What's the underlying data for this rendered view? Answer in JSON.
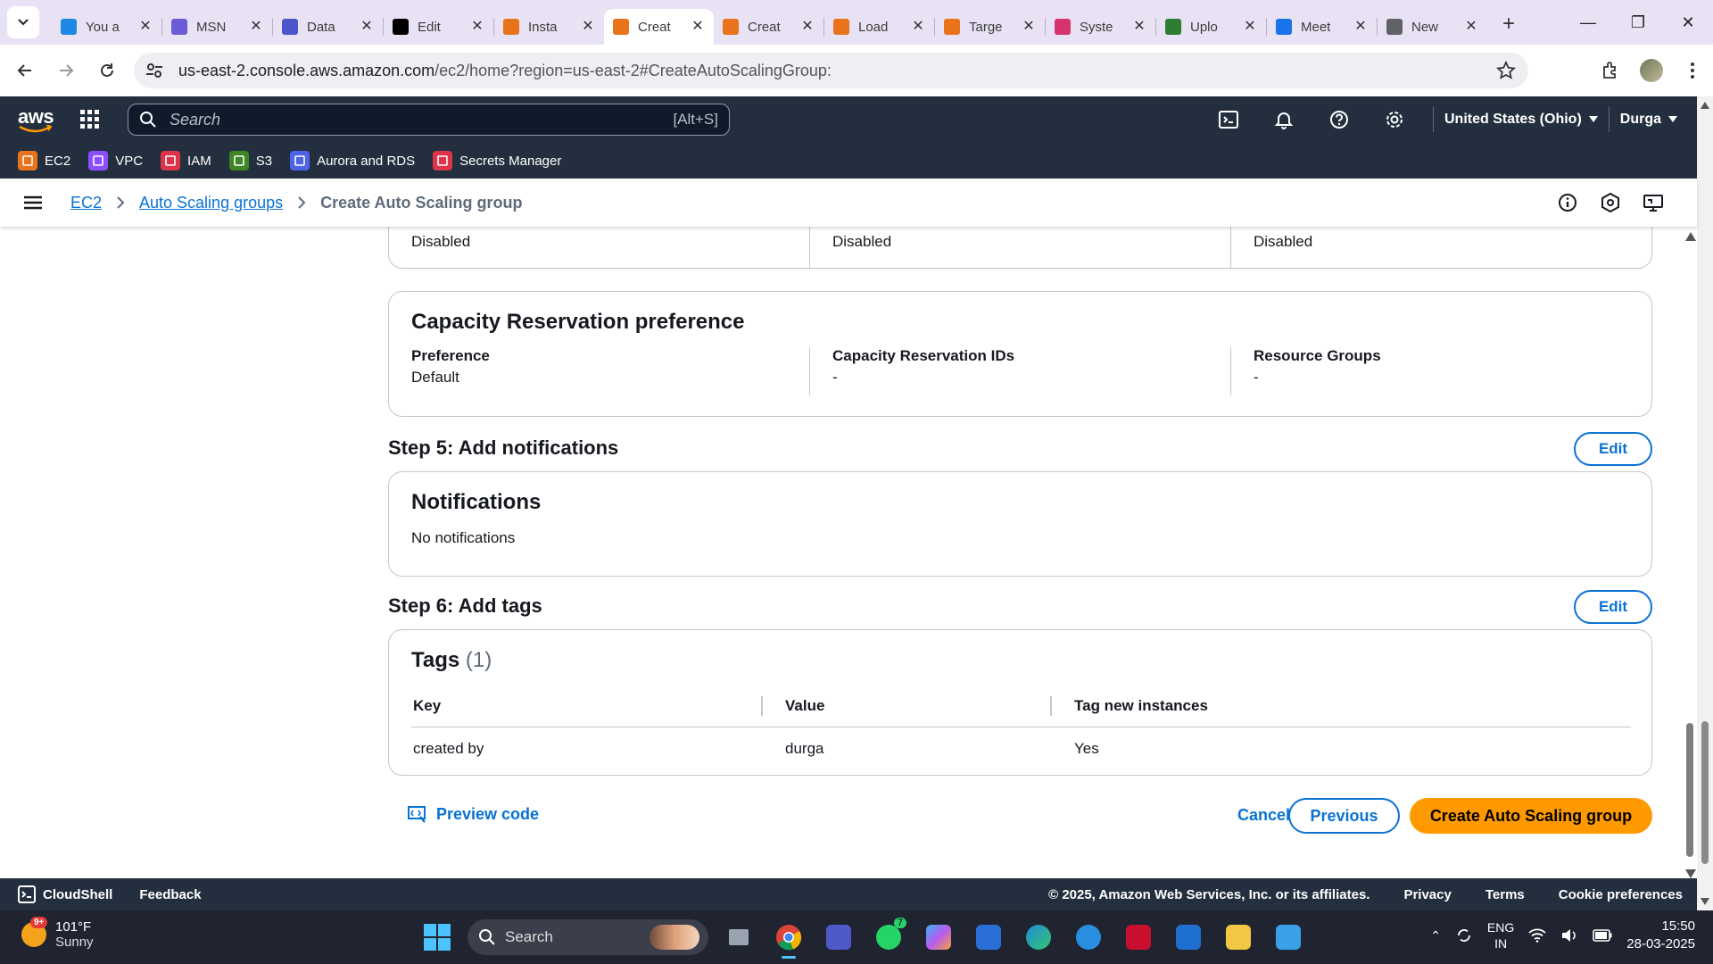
{
  "browser": {
    "tabs": [
      {
        "title": "You a",
        "favicon": "s-icon",
        "color": "#1e88e5",
        "active": false
      },
      {
        "title": "MSN",
        "favicon": "msn-icon",
        "color": "#6b5bd6",
        "active": false
      },
      {
        "title": "Data",
        "favicon": "data-icon",
        "color": "#4a56c9",
        "active": false
      },
      {
        "title": "Edit",
        "favicon": "dev-icon",
        "color": "#000000",
        "active": false
      },
      {
        "title": "Insta",
        "favicon": "aws-icon",
        "color": "#e8731a",
        "active": false
      },
      {
        "title": "Creat",
        "favicon": "aws-icon",
        "color": "#e8731a",
        "active": true
      },
      {
        "title": "Creat",
        "favicon": "aws-icon",
        "color": "#e8731a",
        "active": false
      },
      {
        "title": "Load",
        "favicon": "aws-icon",
        "color": "#e8731a",
        "active": false
      },
      {
        "title": "Targe",
        "favicon": "aws-icon",
        "color": "#e8731a",
        "active": false
      },
      {
        "title": "Syste",
        "favicon": "systems-manager-icon",
        "color": "#d6336c",
        "active": false
      },
      {
        "title": "Uplo",
        "favicon": "upload-icon",
        "color": "#2e7d32",
        "active": false
      },
      {
        "title": "Meet",
        "favicon": "meet-icon",
        "color": "#1a73e8",
        "active": false
      },
      {
        "title": "New",
        "favicon": "chrome-icon",
        "color": "#5f6368",
        "active": false
      }
    ],
    "url_host": "us-east-2.console.aws.amazon.com",
    "url_path": "/ec2/home?region=us-east-2#CreateAutoScalingGroup:"
  },
  "aws": {
    "logo": "aws",
    "search_placeholder": "Search",
    "search_shortcut": "[Alt+S]",
    "region": "United States (Ohio)",
    "user": "Durga",
    "favorites": [
      {
        "label": "EC2",
        "color": "#e8731a"
      },
      {
        "label": "VPC",
        "color": "#8c4fff"
      },
      {
        "label": "IAM",
        "color": "#dd344c"
      },
      {
        "label": "S3",
        "color": "#3f8624"
      },
      {
        "label": "Aurora and RDS",
        "color": "#4d63e8"
      },
      {
        "label": "Secrets Manager",
        "color": "#dd344c"
      }
    ]
  },
  "breadcrumb": {
    "items": [
      "EC2",
      "Auto Scaling groups"
    ],
    "current": "Create Auto Scaling group"
  },
  "content": {
    "top_partial": {
      "values": [
        "Disabled",
        "Disabled",
        "Disabled"
      ]
    },
    "capacity": {
      "title": "Capacity Reservation preference",
      "cols": [
        {
          "label": "Preference",
          "value": "Default"
        },
        {
          "label": "Capacity Reservation IDs",
          "value": "-"
        },
        {
          "label": "Resource Groups",
          "value": "-"
        }
      ]
    },
    "step5": {
      "title": "Step 5: Add notifications",
      "edit": "Edit"
    },
    "notifications": {
      "title": "Notifications",
      "text": "No notifications"
    },
    "step6": {
      "title": "Step 6: Add tags",
      "edit": "Edit"
    },
    "tags": {
      "title": "Tags",
      "count": "(1)",
      "columns": [
        "Key",
        "Value",
        "Tag new instances"
      ],
      "rows": [
        [
          "created by",
          "durga",
          "Yes"
        ]
      ]
    },
    "actions": {
      "preview": "Preview code",
      "cancel": "Cancel",
      "previous": "Previous",
      "create": "Create Auto Scaling group"
    }
  },
  "footer": {
    "cloudshell": "CloudShell",
    "feedback": "Feedback",
    "copyright": "© 2025, Amazon Web Services, Inc. or its affiliates.",
    "links": [
      "Privacy",
      "Terms",
      "Cookie preferences"
    ]
  },
  "taskbar": {
    "weather_temp": "101°F",
    "weather_desc": "Sunny",
    "weather_badge": "9+",
    "search": "Search",
    "lang1": "ENG",
    "lang2": "IN",
    "time": "15:50",
    "date": "28-03-2025",
    "teams_badge": "7"
  }
}
